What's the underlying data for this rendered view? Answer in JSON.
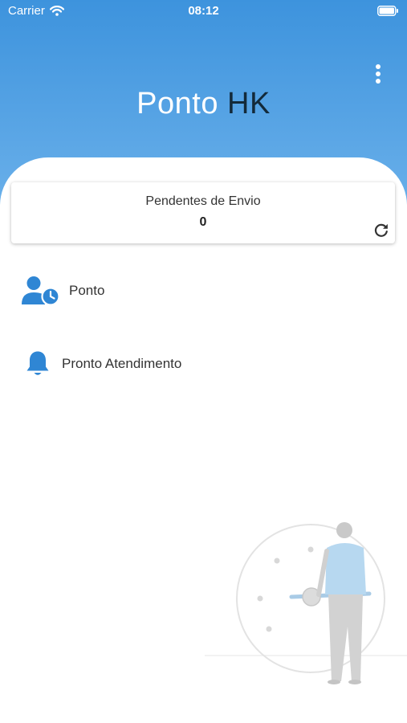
{
  "status_bar": {
    "carrier": "Carrier",
    "time": "08:12"
  },
  "header": {
    "title_part1": "Ponto",
    "title_part2": "HK"
  },
  "pending_card": {
    "title": "Pendentes de Envio",
    "count": "0"
  },
  "menu": [
    {
      "label": "Ponto",
      "icon": "user-clock-icon"
    },
    {
      "label": "Pronto Atendimento",
      "icon": "bell-icon"
    }
  ],
  "colors": {
    "header_top": "#3d93dd",
    "header_bottom": "#6ab0ea",
    "accent": "#2f86d4",
    "title_dark": "#132a3a"
  }
}
